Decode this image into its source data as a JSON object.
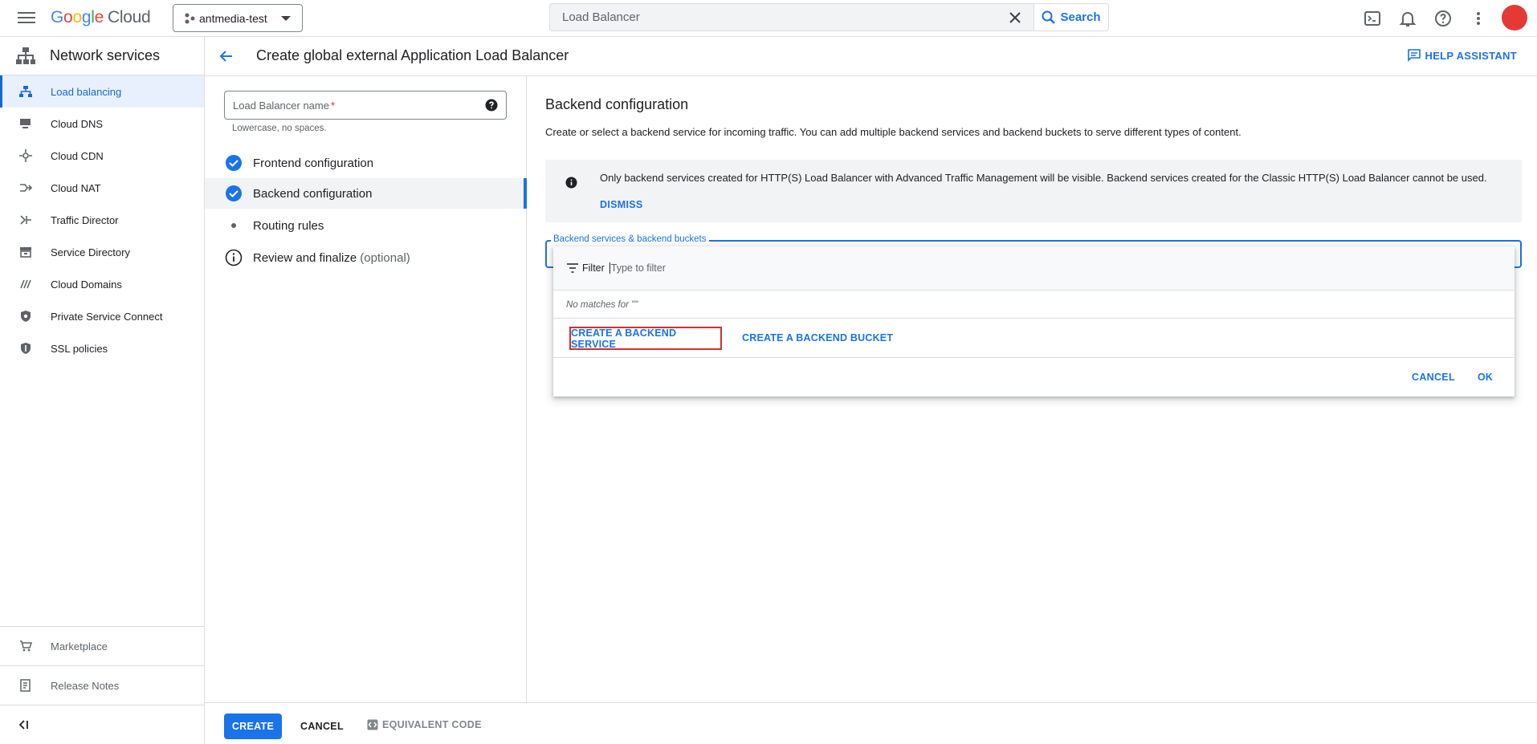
{
  "topbar": {
    "logo_google": "Google",
    "logo_cloud": "Cloud",
    "project_name": "antmedia-test",
    "search_value": "Load Balancer",
    "search_button": "Search",
    "avatar_color": "#e53935"
  },
  "sidebar": {
    "title": "Network services",
    "items": [
      {
        "label": "Load balancing",
        "icon": "load-balancing-icon",
        "active": true
      },
      {
        "label": "Cloud DNS",
        "icon": "dns-icon"
      },
      {
        "label": "Cloud CDN",
        "icon": "cdn-icon"
      },
      {
        "label": "Cloud NAT",
        "icon": "nat-icon"
      },
      {
        "label": "Traffic Director",
        "icon": "traffic-director-icon"
      },
      {
        "label": "Service Directory",
        "icon": "service-directory-icon"
      },
      {
        "label": "Cloud Domains",
        "icon": "domains-icon"
      },
      {
        "label": "Private Service Connect",
        "icon": "private-service-connect-icon"
      },
      {
        "label": "SSL policies",
        "icon": "ssl-policies-icon"
      }
    ],
    "bottom": [
      {
        "label": "Marketplace",
        "icon": "marketplace-icon"
      },
      {
        "label": "Release Notes",
        "icon": "release-notes-icon"
      }
    ]
  },
  "header": {
    "title": "Create global external Application Load Balancer",
    "help_assistant": "HELP ASSISTANT"
  },
  "steps": {
    "name_label": "Load Balancer name",
    "name_required": "*",
    "name_hint": "Lowercase, no spaces.",
    "items": [
      {
        "label": "Frontend configuration",
        "state": "done"
      },
      {
        "label": "Backend configuration",
        "state": "done",
        "current": true
      },
      {
        "label": "Routing rules",
        "state": "pending"
      },
      {
        "label": "Review and finalize",
        "optional": "(optional)",
        "state": "info"
      }
    ]
  },
  "main": {
    "section_title": "Backend configuration",
    "section_desc": "Create or select a backend service for incoming traffic. You can add multiple backend services and backend buckets to serve different types of content.",
    "info_text": "Only backend services created for HTTP(S) Load Balancer with Advanced Traffic Management will be visible. Backend services created for the Classic HTTP(S) Load Balancer cannot be used.",
    "dismiss": "DISMISS",
    "backend_field_label": "Backend services & backend buckets"
  },
  "dropdown": {
    "filter_label": "Filter",
    "filter_placeholder": "Type to filter",
    "no_matches": "No matches for \"\"",
    "create_service": "CREATE A BACKEND SERVICE",
    "create_bucket": "CREATE A BACKEND BUCKET",
    "cancel": "CANCEL",
    "ok": "OK"
  },
  "footer": {
    "create": "CREATE",
    "cancel": "CANCEL",
    "equivalent_code": "EQUIVALENT CODE"
  },
  "colors": {
    "accent": "#1a73e8",
    "highlight_border": "#d32f2f"
  }
}
